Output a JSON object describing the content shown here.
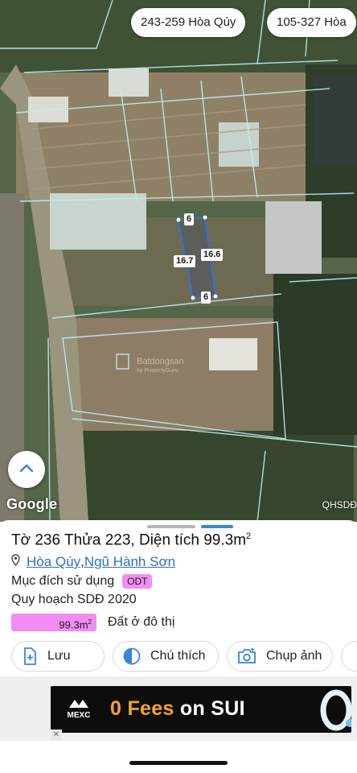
{
  "map": {
    "chip_1": "243-259 Hòa Qúy",
    "chip_2": "105-327 Hòa",
    "dim_top": "6",
    "dim_left": "16.7",
    "dim_right": "16.6",
    "dim_bottom": "6",
    "google_label": "Google",
    "qh_label": "QHSDĐ",
    "watermark": "Batdongsan",
    "watermark_sub": "by PropertyGuru"
  },
  "parcel": {
    "title_prefix": "Tờ 236 Thửa 223, Diện tích 99.3m",
    "title_sup": "2",
    "ward": "Hòa Qúy",
    "separator": ", ",
    "district": "Ngũ Hành Sơn",
    "purpose_label": "Mục đích sử dụng",
    "purpose_code": "ODT",
    "plan_label": "Quy hoạch SDĐ 2020",
    "area_value": "99.3m",
    "area_sup": "2",
    "land_type": "Đất ở đô thị"
  },
  "actions": {
    "save": "Lưu",
    "legend": "Chú thích",
    "photo": "Chụp ảnh"
  },
  "ad": {
    "brand": "MEXC",
    "text_1": "0 Fees ",
    "text_2": "on SUI"
  },
  "colors": {
    "odt": "#f18df2",
    "link": "#2f6fc0",
    "accent": "#3a86d9"
  }
}
